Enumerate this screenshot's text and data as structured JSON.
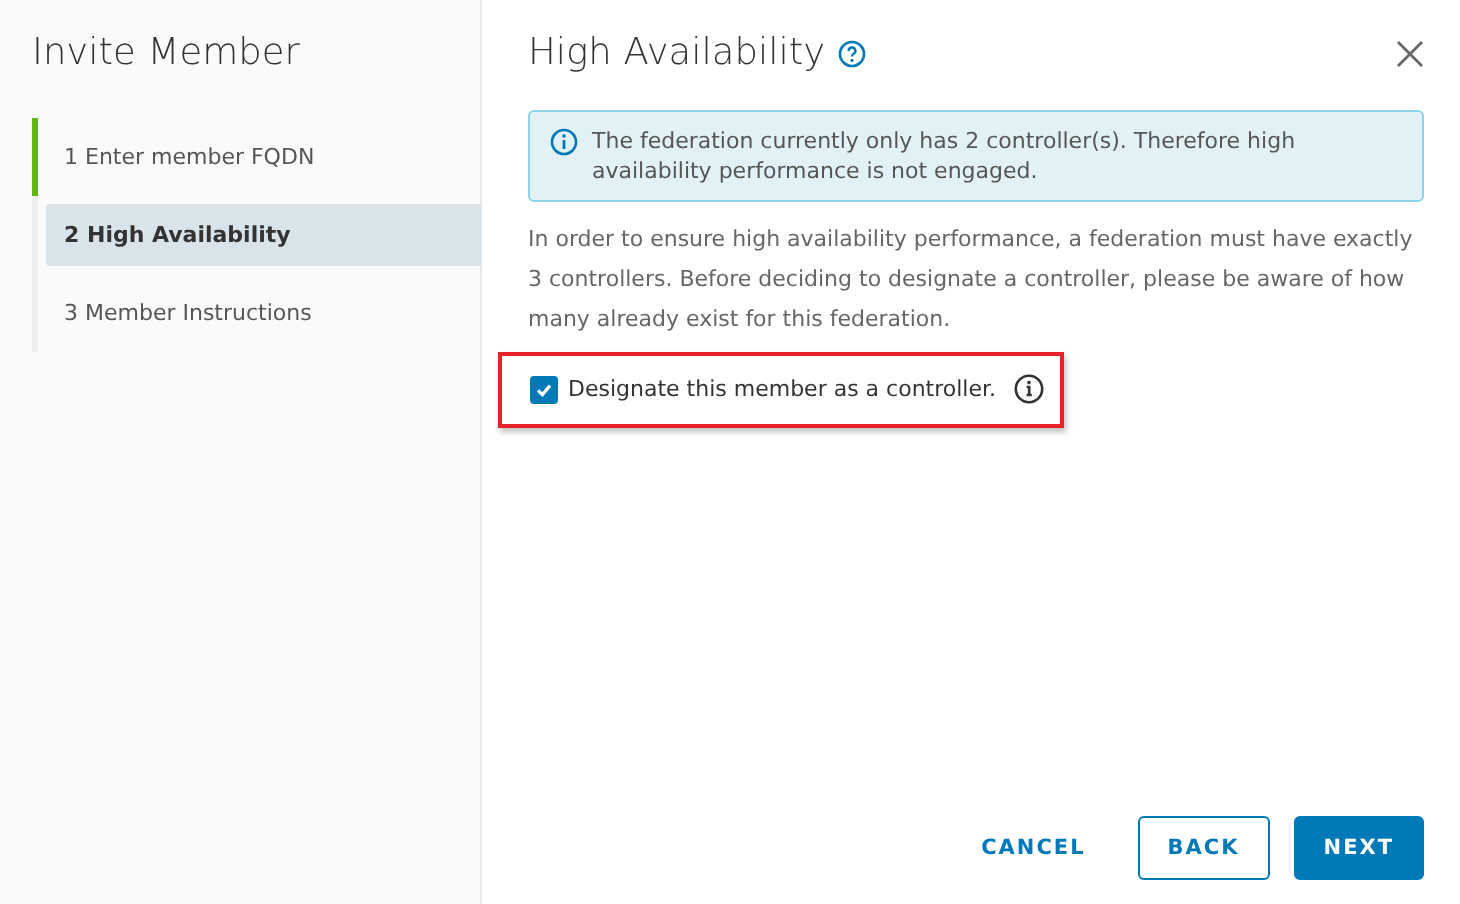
{
  "sidebar": {
    "title": "Invite Member",
    "steps": [
      {
        "label": "1 Enter member FQDN",
        "completed": true,
        "selected": false
      },
      {
        "label": "2 High Availability",
        "completed": false,
        "selected": true
      },
      {
        "label": "3 Member Instructions",
        "completed": false,
        "selected": false
      }
    ]
  },
  "main": {
    "title": "High Availability",
    "alert": "The federation currently only has 2 controller(s). Therefore high availability performance is not engaged.",
    "description": "In order to ensure high availability performance, a federation must have exactly 3 controllers. Before deciding to designate a controller, please be aware of how many already exist for this federation.",
    "checkbox": {
      "label": "Designate this member as a controller.",
      "checked": true,
      "highlighted": true
    }
  },
  "buttons": [
    {
      "label": "CANCEL",
      "kind": "link"
    },
    {
      "label": "BACK",
      "kind": "outline"
    },
    {
      "label": "NEXT",
      "kind": "primary"
    }
  ]
}
